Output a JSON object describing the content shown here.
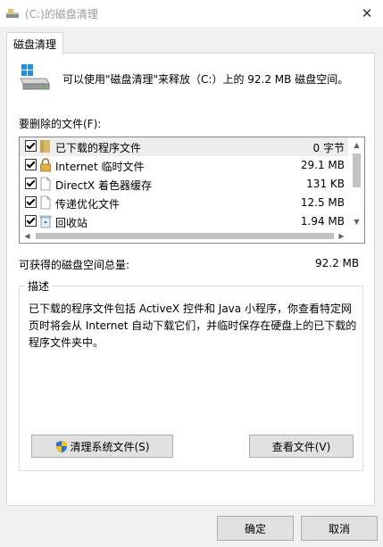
{
  "window": {
    "title": "(C:)的磁盘清理",
    "close_glyph": "✕"
  },
  "tab": {
    "label": "磁盘清理"
  },
  "summary": {
    "text": "可以使用\"磁盘清理\"来释放（C:）上的 92.2 MB 磁盘空间。"
  },
  "files": {
    "label": "要删除的文件(F):",
    "items": [
      {
        "name": "已下载的程序文件",
        "size": "0 字节",
        "checked": true,
        "icon": "folder-icon"
      },
      {
        "name": "Internet 临时文件",
        "size": "29.1 MB",
        "checked": true,
        "icon": "lock-icon"
      },
      {
        "name": "DirectX 着色器缓存",
        "size": "131 KB",
        "checked": true,
        "icon": "file-icon"
      },
      {
        "name": "传递优化文件",
        "size": "12.5 MB",
        "checked": true,
        "icon": "file-icon"
      },
      {
        "name": "回收站",
        "size": "1.94 MB",
        "checked": true,
        "icon": "recycle-bin-icon"
      }
    ]
  },
  "total": {
    "label": "可获得的磁盘空间总量:",
    "value": "92.2 MB"
  },
  "description": {
    "legend": "描述",
    "text": "已下载的程序文件包括 ActiveX 控件和 Java 小程序，你查看特定网页时将会从 Internet 自动下载它们，并临时保存在硬盘上的已下载的程序文件夹中。"
  },
  "buttons": {
    "clean_system": "清理系统文件(S)",
    "view_files": "查看文件(V)",
    "ok": "确定",
    "cancel": "取消"
  },
  "colors": {
    "window_bg": "#f0f0f0",
    "panel_bg": "#ffffff",
    "button_bg": "#e1e1e1",
    "title_text": "#9a9a9a",
    "selection_bg": "#eeeeee"
  }
}
